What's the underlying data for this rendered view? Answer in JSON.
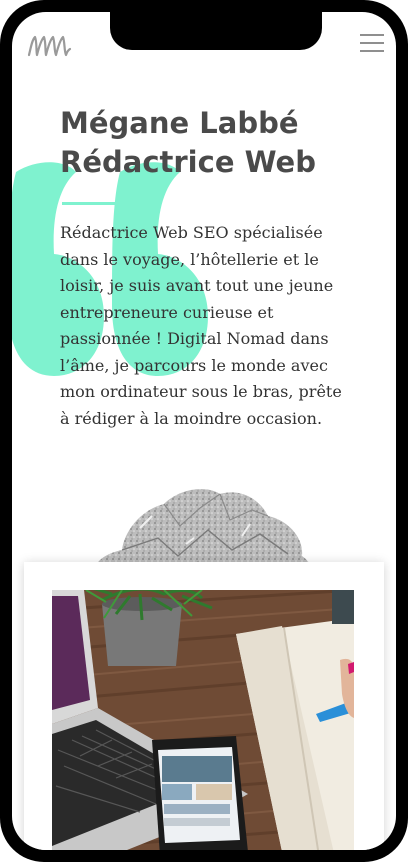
{
  "header": {
    "logo_icon": "handwritten-m-logo",
    "menu_icon": "hamburger-menu-icon"
  },
  "hero": {
    "name": "Mégane Labbé",
    "role": "Rédactrice Web",
    "bio": "Rédactrice Web SEO spécialisée dans le voyage, l’hôtellerie et le loisir, je suis avant tout une jeune entrepreneure curieuse et passionnée ! Digital Nomad dans l’âme, je parcours le monde avec mon ordinateur sous le bras, prête à rédiger à la moindre occasion."
  },
  "decorations": {
    "quote_icon": "quote-mark-icon",
    "paper_ball": "crumpled-paper-image"
  },
  "photo": {
    "subject": "laptop-phone-notebook-desk-photo"
  },
  "colors": {
    "accent": "#7ff2cf",
    "heading": "#4a4a4a",
    "text": "#333333",
    "frame": "#000000"
  }
}
